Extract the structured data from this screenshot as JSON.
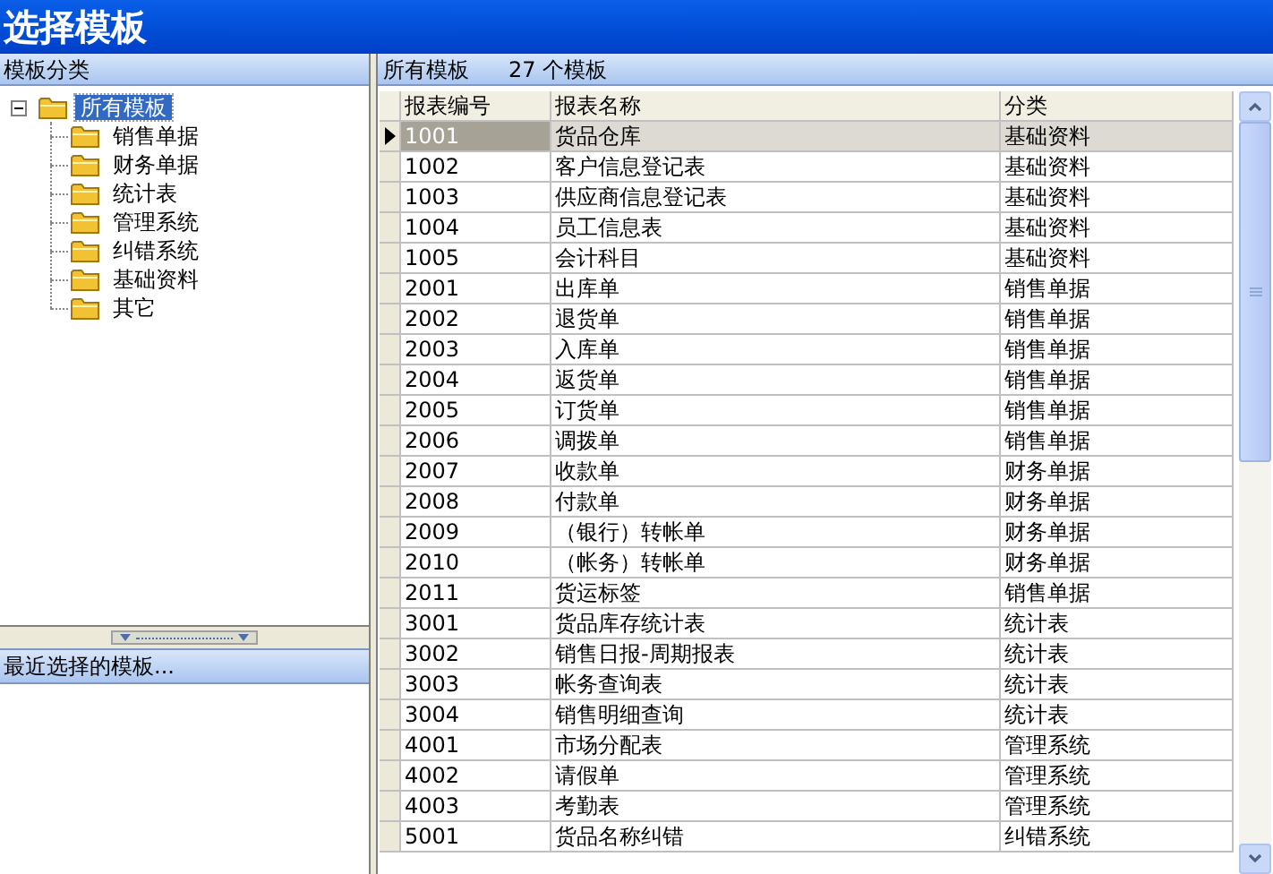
{
  "window": {
    "title": "选择模板"
  },
  "left_panel": {
    "header": "模板分类",
    "tree": [
      {
        "label": "所有模板",
        "selected": true,
        "expanded": true,
        "children": [
          {
            "label": "销售单据",
            "selected": false
          },
          {
            "label": "财务单据",
            "selected": false
          },
          {
            "label": "统计表",
            "selected": false
          },
          {
            "label": "管理系统",
            "selected": false
          },
          {
            "label": "纠错系统",
            "selected": false
          },
          {
            "label": "基础资料",
            "selected": false
          },
          {
            "label": "其它",
            "selected": false
          }
        ]
      }
    ],
    "recent_header": "最近选择的模板..."
  },
  "right_panel": {
    "header": "所有模板",
    "count": "27 个模板",
    "table": {
      "columns": [
        "报表编号",
        "报表名称",
        "分类"
      ],
      "rows": [
        {
          "cells": [
            "1001",
            "货品仓库",
            "基础资料"
          ],
          "selected": true
        },
        {
          "cells": [
            "1002",
            "客户信息登记表",
            "基础资料"
          ],
          "selected": false
        },
        {
          "cells": [
            "1003",
            "供应商信息登记表",
            "基础资料"
          ],
          "selected": false
        },
        {
          "cells": [
            "1004",
            "员工信息表",
            "基础资料"
          ],
          "selected": false
        },
        {
          "cells": [
            "1005",
            "会计科目",
            "基础资料"
          ],
          "selected": false
        },
        {
          "cells": [
            "2001",
            "出库单",
            "销售单据"
          ],
          "selected": false
        },
        {
          "cells": [
            "2002",
            "退货单",
            "销售单据"
          ],
          "selected": false
        },
        {
          "cells": [
            "2003",
            "入库单",
            "销售单据"
          ],
          "selected": false
        },
        {
          "cells": [
            "2004",
            "返货单",
            "销售单据"
          ],
          "selected": false
        },
        {
          "cells": [
            "2005",
            "订货单",
            "销售单据"
          ],
          "selected": false
        },
        {
          "cells": [
            "2006",
            "调拨单",
            "销售单据"
          ],
          "selected": false
        },
        {
          "cells": [
            "2007",
            "收款单",
            "财务单据"
          ],
          "selected": false
        },
        {
          "cells": [
            "2008",
            "付款单",
            "财务单据"
          ],
          "selected": false
        },
        {
          "cells": [
            "2009",
            "（银行）转帐单",
            "财务单据"
          ],
          "selected": false
        },
        {
          "cells": [
            "2010",
            "（帐务）转帐单",
            "财务单据"
          ],
          "selected": false
        },
        {
          "cells": [
            "2011",
            "货运标签",
            "销售单据"
          ],
          "selected": false
        },
        {
          "cells": [
            "3001",
            "货品库存统计表",
            "统计表"
          ],
          "selected": false
        },
        {
          "cells": [
            "3002",
            "销售日报-周期报表",
            "统计表"
          ],
          "selected": false
        },
        {
          "cells": [
            "3003",
            "帐务查询表",
            "统计表"
          ],
          "selected": false
        },
        {
          "cells": [
            "3004",
            "销售明细查询",
            "统计表"
          ],
          "selected": false
        },
        {
          "cells": [
            "4001",
            "市场分配表",
            "管理系统"
          ],
          "selected": false
        },
        {
          "cells": [
            "4002",
            "请假单",
            "管理系统"
          ],
          "selected": false
        },
        {
          "cells": [
            "4003",
            "考勤表",
            "管理系统"
          ],
          "selected": false
        },
        {
          "cells": [
            "5001",
            "货品名称纠错",
            "纠错系统"
          ],
          "selected": false
        }
      ]
    }
  }
}
